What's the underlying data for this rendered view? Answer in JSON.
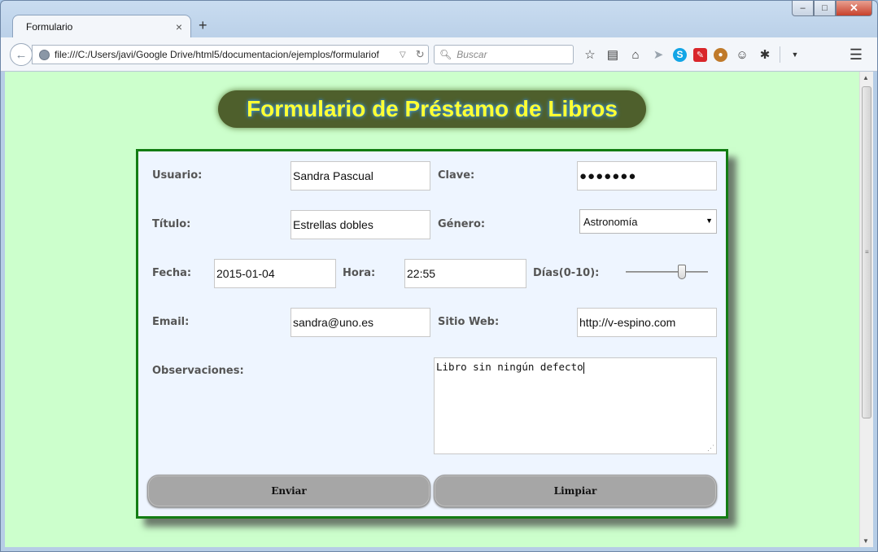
{
  "browser": {
    "tab_title": "Formulario",
    "tab_close": "×",
    "new_tab": "+",
    "url": "file:///C:/Users/javi/Google Drive/html5/documentacion/ejemplos/formulariof",
    "search_placeholder": "Buscar",
    "window_controls": {
      "minimize": "–",
      "maximize": "□",
      "close": "✕"
    }
  },
  "page": {
    "heading": "Formulario de Préstamo de Libros"
  },
  "form": {
    "usuario": {
      "label": "Usuario:",
      "value": "Sandra Pascual"
    },
    "clave": {
      "label": "Clave:",
      "value": "●●●●●●●"
    },
    "titulo": {
      "label": "Título:",
      "value": "Estrellas dobles"
    },
    "genero": {
      "label": "Género:",
      "selected": "Astronomía"
    },
    "fecha": {
      "label": "Fecha:",
      "value": "2015-01-04"
    },
    "hora": {
      "label": "Hora:",
      "value": "22:55"
    },
    "dias": {
      "label": "Días(0-10):",
      "value": 7,
      "min": 0,
      "max": 10
    },
    "email": {
      "label": "Email:",
      "value": "sandra@uno.es"
    },
    "web": {
      "label": "Sitio Web:",
      "value": "http://v-espino.com"
    },
    "observaciones": {
      "label": "Observaciones:",
      "value": "Libro sin ningún defecto"
    },
    "submit_label": "Enviar",
    "reset_label": "Limpiar"
  },
  "colors": {
    "page_bg": "#ccffcc",
    "title_bg": "#4e5f2c",
    "title_text": "#ffff33",
    "form_border": "#137d13",
    "form_bg": "#eef5ff"
  }
}
